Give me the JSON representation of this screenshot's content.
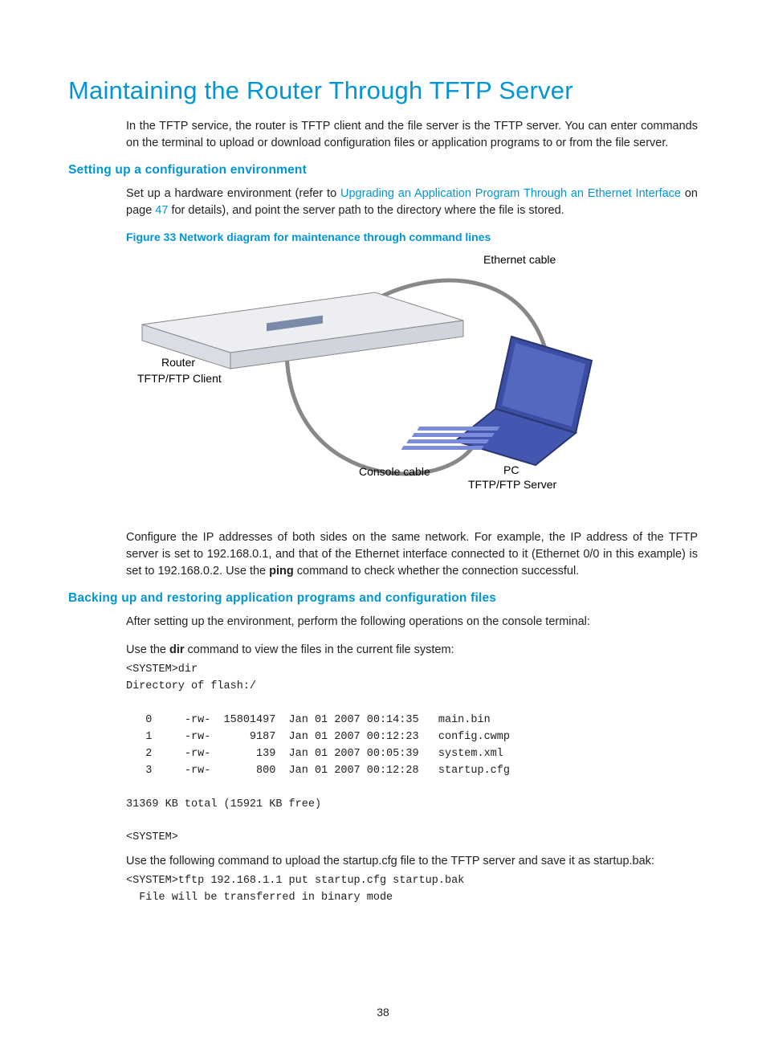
{
  "title": "Maintaining the Router Through TFTP Server",
  "intro": "In the TFTP service, the router is TFTP client and the file server is the TFTP server. You can enter commands on the terminal to upload or download configuration files or application programs to or from the file server.",
  "section1": {
    "heading": "Setting up a configuration environment",
    "para_pre": "Set up a hardware environment (refer to ",
    "link_text": "Upgrading an Application Program Through an Ethernet Interface",
    "para_mid": " on page ",
    "page_ref": "47",
    "para_post": " for details), and point the server path to the directory where the file is stored.",
    "figure_caption": "Figure 33 Network diagram for maintenance through command lines",
    "labels": {
      "ethernet": "Ethernet cable",
      "router": "Router",
      "client": "TFTP/FTP Client",
      "console": "Console cable",
      "pc": "PC",
      "server": "TFTP/FTP Server"
    },
    "para2_a": "Configure the IP addresses of both sides on the same network. For example, the IP address of the TFTP server is set to 192.168.0.1, and that of the Ethernet interface connected to it (Ethernet 0/0 in this example) is set to 192.168.0.2. Use the ",
    "ping": "ping",
    "para2_b": " command to check whether the connection successful."
  },
  "section2": {
    "heading": "Backing up and restoring application programs and configuration files",
    "para1": "After setting up the environment, perform the following operations on the console terminal:",
    "para2_a": "Use the ",
    "dir": "dir",
    "para2_b": " command to view the files in the current file system:",
    "listing1": "<SYSTEM>dir\nDirectory of flash:/\n\n   0     -rw-  15801497  Jan 01 2007 00:14:35   main.bin\n   1     -rw-      9187  Jan 01 2007 00:12:23   config.cwmp\n   2     -rw-       139  Jan 01 2007 00:05:39   system.xml\n   3     -rw-       800  Jan 01 2007 00:12:28   startup.cfg\n\n31369 KB total (15921 KB free)\n\n<SYSTEM>",
    "para3": "Use the following command to upload the startup.cfg file to the TFTP server and save it as startup.bak:",
    "listing2": "<SYSTEM>tftp 192.168.1.1 put startup.cfg startup.bak\n  File will be transferred in binary mode"
  },
  "page_number": "38"
}
